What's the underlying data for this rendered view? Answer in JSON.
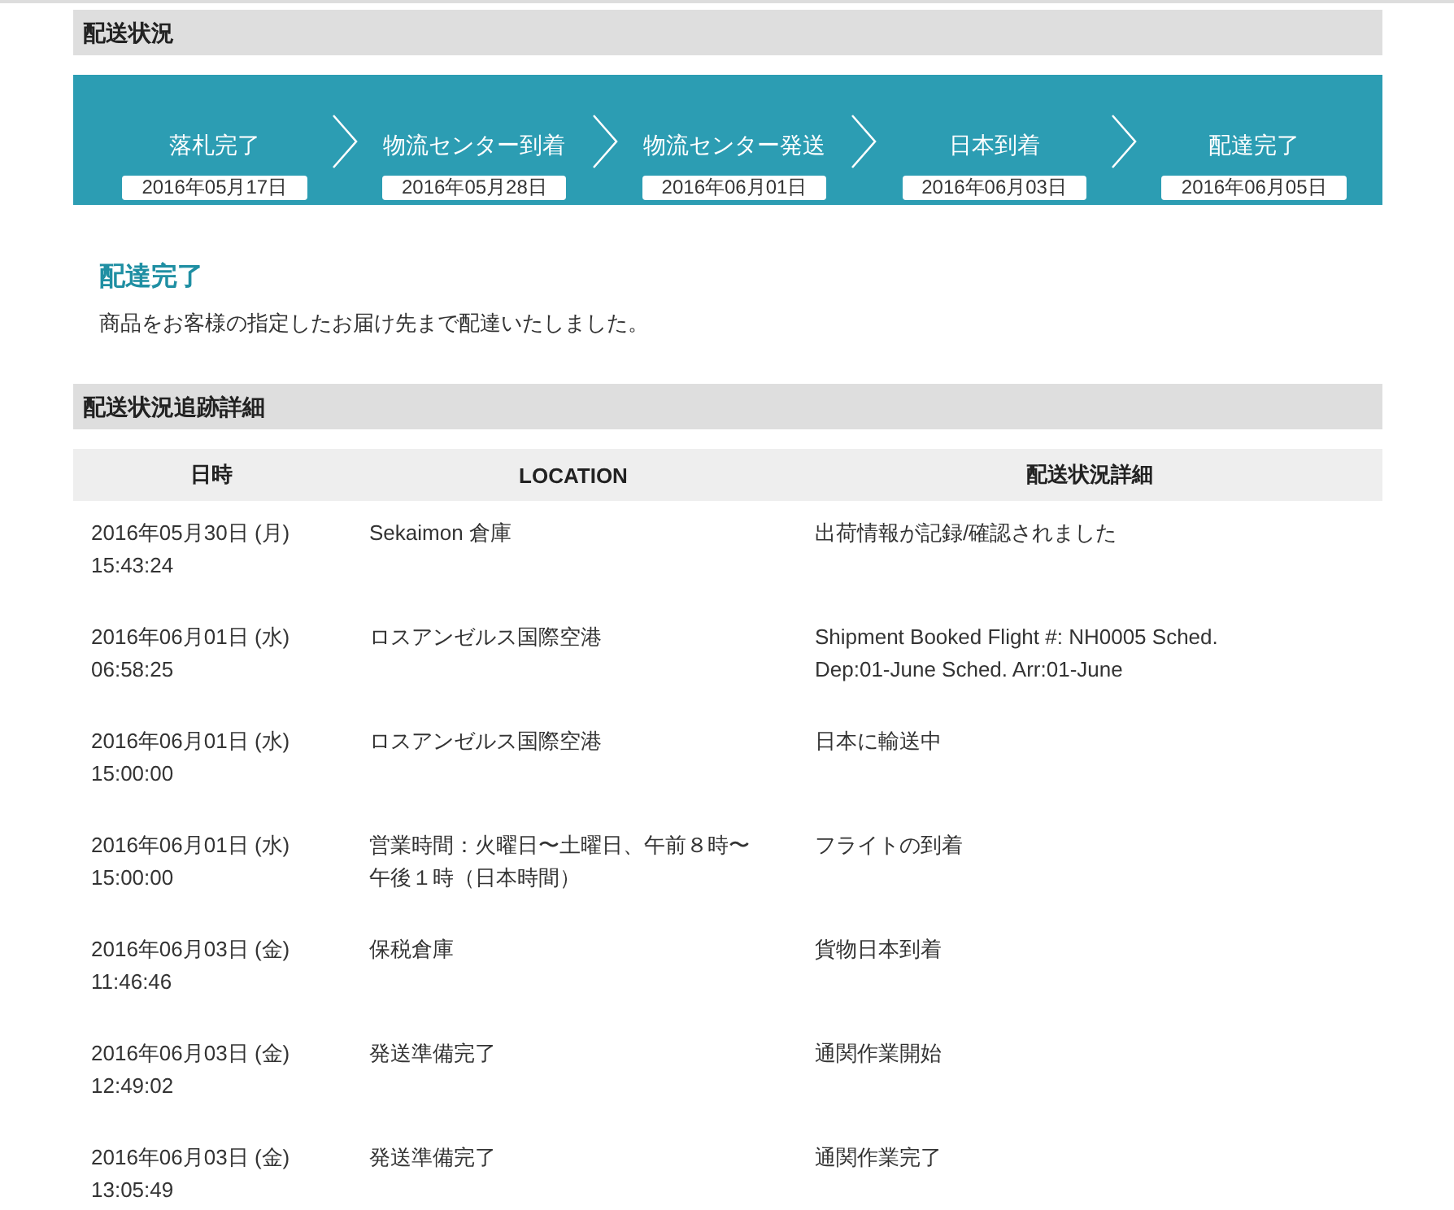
{
  "status_header": {
    "title": "配送状況"
  },
  "steps": [
    {
      "label": "落札完了",
      "date": "2016年05月17日"
    },
    {
      "label": "物流センター到着",
      "date": "2016年05月28日"
    },
    {
      "label": "物流センター発送",
      "date": "2016年06月01日"
    },
    {
      "label": "日本到着",
      "date": "2016年06月03日"
    },
    {
      "label": "配達完了",
      "date": "2016年06月05日"
    }
  ],
  "current_status": {
    "title": "配達完了",
    "message": "商品をお客様の指定したお届け先まで配達いたしました。"
  },
  "tracking_header": {
    "title": "配送状況追跡詳細"
  },
  "table": {
    "columns": [
      "日時",
      "LOCATION",
      "配送状況詳細"
    ],
    "rows": [
      {
        "date": "2016年05月30日 (月)",
        "time": "15:43:24",
        "location": "Sekaimon 倉庫",
        "detail": "出荷情報が記録/確認されました"
      },
      {
        "date": "2016年06月01日 (水)",
        "time": "06:58:25",
        "location": "ロスアンゼルス国際空港",
        "detail": "Shipment Booked Flight #: NH0005 Sched. Dep:01-June Sched. Arr:01-June"
      },
      {
        "date": "2016年06月01日 (水)",
        "time": "15:00:00",
        "location": "ロスアンゼルス国際空港",
        "detail": "日本に輸送中"
      },
      {
        "date": "2016年06月01日 (水)",
        "time": "15:00:00",
        "location": "営業時間：火曜日〜土曜日、午前８時〜午後１時（日本時間）",
        "detail": "フライトの到着"
      },
      {
        "date": "2016年06月03日 (金)",
        "time": "11:46:46",
        "location": "保税倉庫",
        "detail": "貨物日本到着"
      },
      {
        "date": "2016年06月03日 (金)",
        "time": "12:49:02",
        "location": "発送準備完了",
        "detail": "通関作業開始"
      },
      {
        "date": "2016年06月03日 (金)",
        "time": "13:05:49",
        "location": "発送準備完了",
        "detail": "通関作業完了"
      }
    ]
  }
}
